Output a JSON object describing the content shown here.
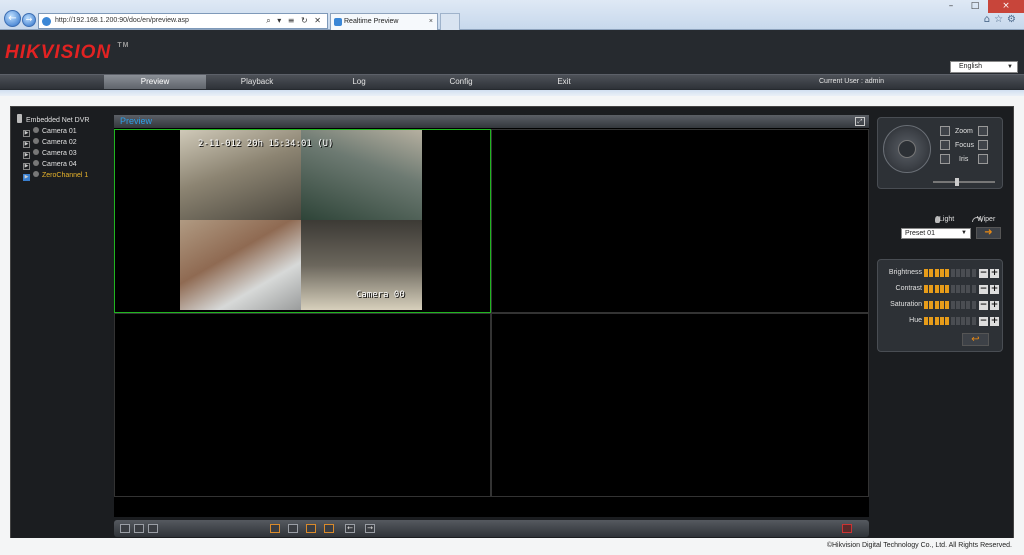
{
  "browser": {
    "url": "http://192.168.1.200:90/doc/en/preview.asp",
    "tab_title": "Realtime Preview",
    "address_tools": "⌕ ▾ ≡ ↻ ✕"
  },
  "header": {
    "logo": "HIKVISION",
    "logo_tm": "TM",
    "language": "English",
    "menu": [
      "Preview",
      "Playback",
      "Log",
      "Config",
      "Exit"
    ],
    "current_user": "Current User : admin"
  },
  "tree": {
    "root": "Embedded Net DVR",
    "cameras": [
      "Camera 01",
      "Camera 02",
      "Camera 03",
      "Camera 04",
      "ZeroChannel 1"
    ]
  },
  "preview": {
    "title": "Preview",
    "osd_time": "2-11-012 20h 15:34:01 (U)",
    "osd_camera": "Camera 00"
  },
  "ptz": {
    "zoom": "Zoom",
    "focus": "Focus",
    "iris": "Iris",
    "light": "Light",
    "wiper": "Wiper",
    "preset": "Preset 01"
  },
  "image_adjust": {
    "items": [
      {
        "label": "Brightness",
        "level": 5,
        "max": 10
      },
      {
        "label": "Contrast",
        "level": 5,
        "max": 10
      },
      {
        "label": "Saturation",
        "level": 5,
        "max": 10
      },
      {
        "label": "Hue",
        "level": 5,
        "max": 10
      }
    ]
  },
  "footer": {
    "copyright": "©Hikvision Digital Technology Co., Ltd. All Rights Reserved."
  },
  "colors": {
    "brand_red": "#e22222",
    "title_blue": "#2d9ee8",
    "zero_channel": "#e7b32b",
    "selected_border": "#1fb51f",
    "level_on": "#e79c1a"
  }
}
